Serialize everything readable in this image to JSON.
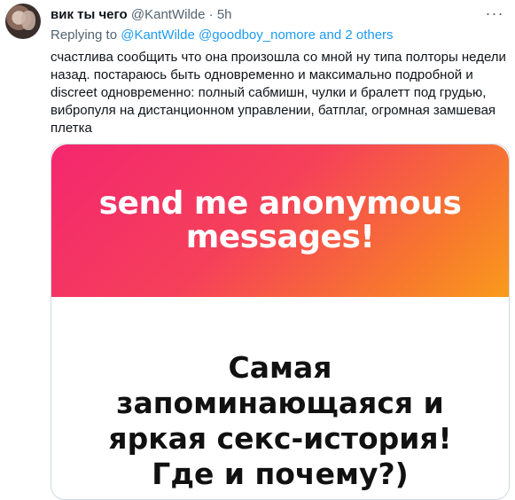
{
  "tweet": {
    "author_name": "вик ты чего",
    "handle": "@KantWilde",
    "separator": "·",
    "time": "5h",
    "more_icon": "more-horizontal-icon",
    "replying_prefix": "Replying to",
    "replying_to": [
      "@KantWilde",
      "@goodboy_nomore"
    ],
    "replying_and": "and",
    "replying_others": "2 others",
    "text": "счастлива сообщить что она произошла со мной ну типа полторы недели назад. постараюсь быть одновременно и максимально подробной и discreet одновременно: полный сабмишн, чулки и бралетт под грудью, вибропуля на дистанционном управлении, батплаг, огромная замшевая плетка"
  },
  "media": {
    "banner_lines": [
      "send me anonymous",
      "messages!"
    ],
    "question_lines": [
      "Самая",
      "запоминающаяся и",
      "яркая секс-история!",
      "Где и почему?)"
    ],
    "gradient_colors": [
      "#f4276f",
      "#f7792d",
      "#f89a1c"
    ]
  },
  "colors": {
    "link": "#1d9bf0",
    "muted": "#536471",
    "text": "#0f1419",
    "border": "#cfd9de"
  }
}
